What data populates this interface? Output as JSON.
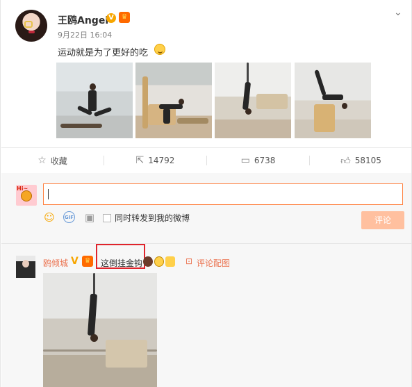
{
  "post": {
    "username": "王鸥Angel",
    "verified_badge": "V",
    "member_badge": "♛",
    "time": "9月22日 16:04",
    "text": "运动就是为了更好的吃",
    "images": [
      "workout-photo-1",
      "workout-photo-2",
      "workout-photo-3",
      "workout-photo-4"
    ]
  },
  "actions": {
    "favorite": {
      "icon": "star-icon",
      "label": "收藏"
    },
    "repost": {
      "icon": "share-icon",
      "label": "14792"
    },
    "comment": {
      "icon": "comment-icon",
      "label": "6738"
    },
    "like": {
      "icon": "thumbs-up-icon",
      "label": "58105"
    }
  },
  "composer": {
    "repost_label": "同时转发到我的微博",
    "submit_label": "评论",
    "gif_label": "GIF",
    "avatar_tag": "Hi~",
    "accent_color": "#ff8140"
  },
  "comment": {
    "username": "鸥倾城",
    "verified_badge": "V",
    "text": "这倒挂金钩",
    "picture_link": "评论配图",
    "link_color": "#eb7350",
    "highlight_color": "#e0242c"
  }
}
